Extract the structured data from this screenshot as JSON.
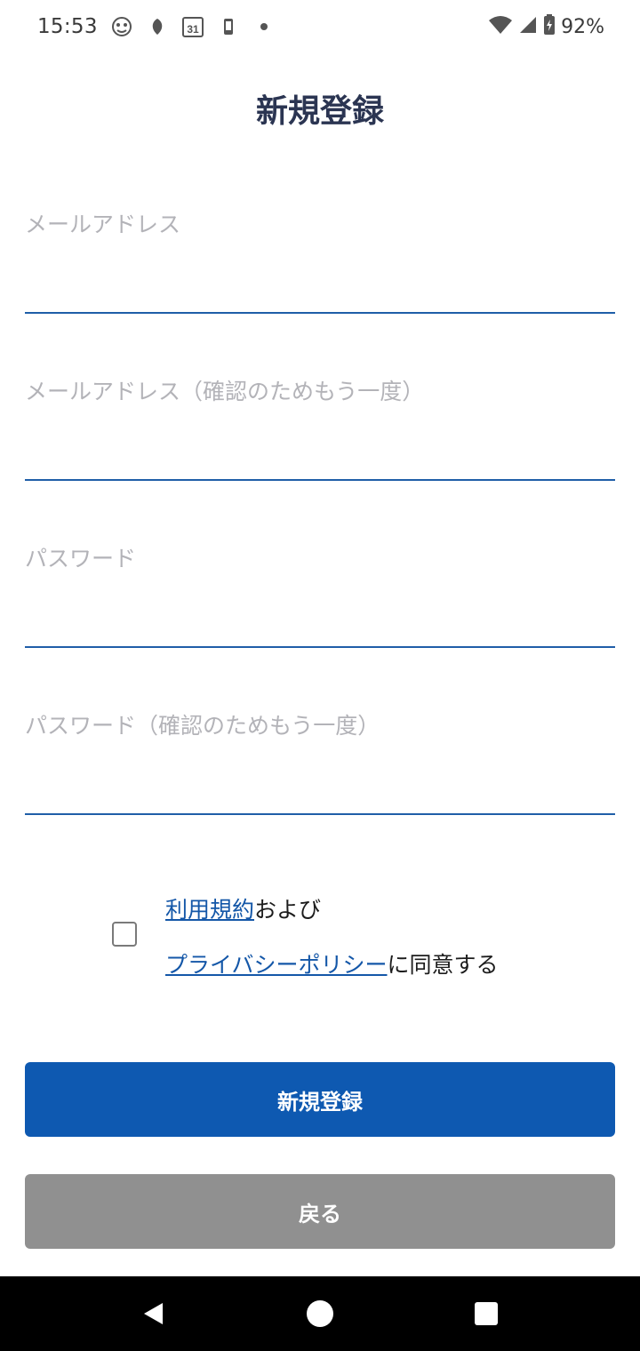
{
  "status_bar": {
    "time": "15:53",
    "notification_icons": [
      "mascot-icon",
      "leaf-icon",
      "calendar-icon",
      "phone-icon",
      "dot-icon"
    ],
    "calendar_day": "31",
    "battery_percent": "92%"
  },
  "page": {
    "title": "新規登録"
  },
  "form": {
    "fields": [
      {
        "label": "メールアドレス",
        "value": ""
      },
      {
        "label": "メールアドレス（確認のためもう一度）",
        "value": ""
      },
      {
        "label": "パスワード",
        "value": ""
      },
      {
        "label": "パスワード（確認のためもう一度）",
        "value": ""
      }
    ],
    "agreement": {
      "checked": false,
      "terms_link": "利用規約",
      "and_text": "および",
      "privacy_link": "プライバシーポリシー",
      "agree_text": "に同意する"
    }
  },
  "buttons": {
    "register": "新規登録",
    "back": "戻る"
  },
  "colors": {
    "title": "#2b3552",
    "primary": "#0e59b1",
    "secondary": "#909090",
    "link": "#1457a8",
    "field_line": "#1f5ea8",
    "placeholder": "#b3b3b8"
  },
  "nav_bar": {
    "buttons": [
      "back-icon",
      "home-icon",
      "recents-icon"
    ]
  }
}
